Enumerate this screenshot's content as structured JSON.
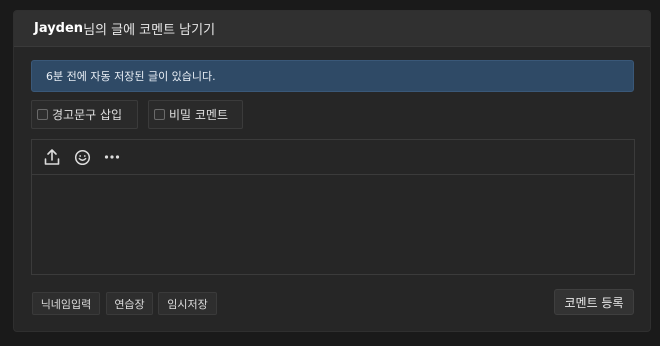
{
  "header": {
    "author": "Jayden",
    "title_suffix": "님의 글에 코멘트 남기기"
  },
  "notice": {
    "text": "6분 전에 자동 저장된 글이 있습니다."
  },
  "options": {
    "warning_insert": {
      "label": "경고문구 삽입",
      "checked": false
    },
    "secret_comment": {
      "label": "비밀 코멘트",
      "checked": false
    }
  },
  "editor": {
    "tools": [
      "upload-icon",
      "emoji-icon",
      "more-icon"
    ],
    "content": ""
  },
  "footer": {
    "nickname_input_label": "닉네임입력",
    "practice_label": "연습장",
    "temp_save_label": "임시저장",
    "submit_label": "코멘트 등록"
  },
  "colors": {
    "background": "#1a1a1a",
    "panel": "#262626",
    "notice": "#2f4a66"
  }
}
